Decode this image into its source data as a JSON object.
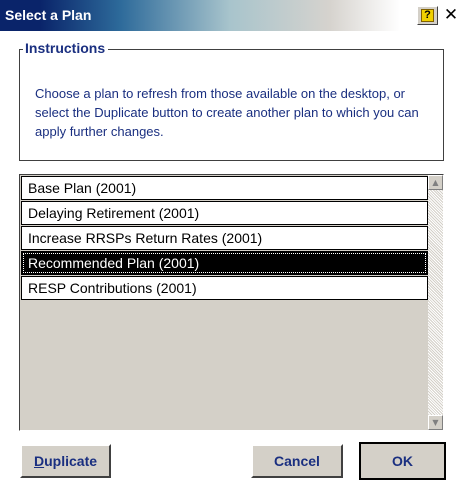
{
  "window": {
    "title": "Select a Plan",
    "help_glyph": "?",
    "close_glyph": "✕"
  },
  "instructions": {
    "label": "Instructions",
    "text": "Choose a plan to refresh from those available on the desktop, or select the Duplicate button to create another plan to which you can apply further changes."
  },
  "plans": {
    "items": [
      {
        "label": "Base Plan (2001)",
        "selected": false
      },
      {
        "label": "Delaying Retirement (2001)",
        "selected": false
      },
      {
        "label": "Increase RRSPs Return Rates (2001)",
        "selected": false
      },
      {
        "label": "Recommended Plan (2001)",
        "selected": true
      },
      {
        "label": "RESP Contributions (2001)",
        "selected": false
      }
    ],
    "scroll_up_glyph": "▲",
    "scroll_down_glyph": "▼"
  },
  "buttons": {
    "duplicate_first": "D",
    "duplicate_rest": "uplicate",
    "cancel": "Cancel",
    "ok": "OK"
  },
  "colors": {
    "title_bar": "#0a246a",
    "accent_text": "#1a2f80",
    "selection": "#000000"
  }
}
